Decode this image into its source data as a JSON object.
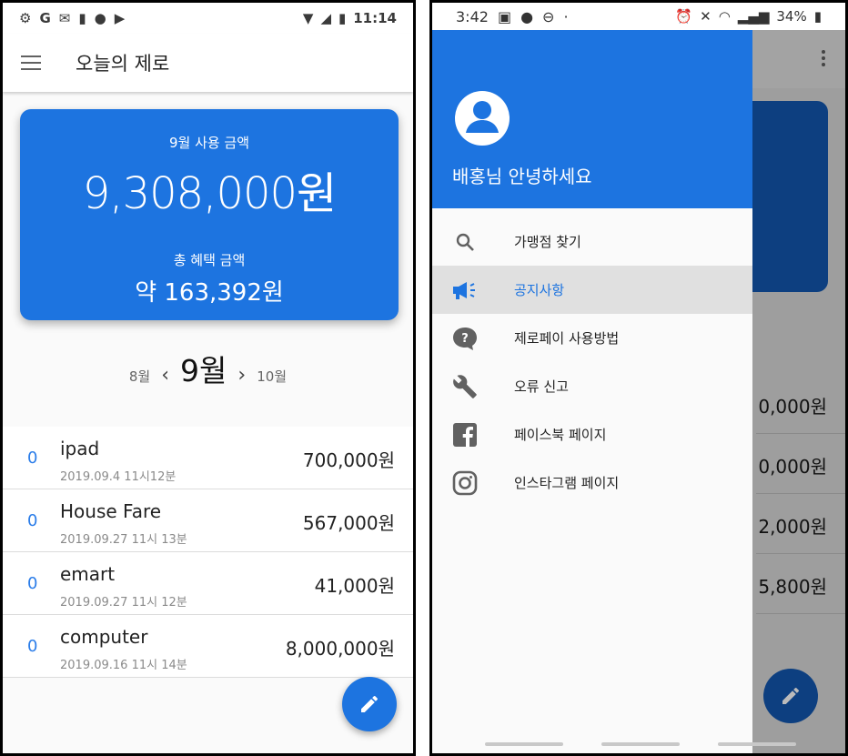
{
  "left_screen": {
    "status_bar": {
      "time": "11:14"
    },
    "appbar": {
      "title": "오늘의 제로"
    },
    "summary_card": {
      "month_label": "9월 사용 금액",
      "month_amount": "9,308,000원",
      "benefit_label": "총 혜택 금액",
      "benefit_amount": "약 163,392원"
    },
    "month_nav": {
      "prev": "8월",
      "current": "9월",
      "next": "10월"
    },
    "transactions": [
      {
        "badge": "0",
        "name": "ipad",
        "date": "2019.09.4 11시12분",
        "amount": "700,000원"
      },
      {
        "badge": "0",
        "name": "House Fare",
        "date": "2019.09.27 11시 13분",
        "amount": "567,000원"
      },
      {
        "badge": "0",
        "name": "emart",
        "date": "2019.09.27 11시 12분",
        "amount": "41,000원"
      },
      {
        "badge": "0",
        "name": "computer",
        "date": "2019.09.16 11시 14분",
        "amount": "8,000,000원"
      }
    ],
    "fab_icon": "pencil-icon",
    "accent_color": "#1d74e0"
  },
  "right_screen": {
    "status_bar": {
      "time": "3:42",
      "battery": "34%"
    },
    "drawer": {
      "greeting": "배홍님 안녕하세요",
      "items": [
        {
          "label": "가맹점 찾기",
          "icon": "search-icon"
        },
        {
          "label": "공지사항",
          "icon": "megaphone-icon",
          "active": true
        },
        {
          "label": "제로페이 사용방법",
          "icon": "help-bubble-icon"
        },
        {
          "label": "오류 신고",
          "icon": "wrench-icon"
        },
        {
          "label": "페이스북 페이지",
          "icon": "facebook-icon"
        },
        {
          "label": "인스타그램 페이지",
          "icon": "instagram-icon"
        }
      ]
    },
    "background_amounts": [
      "0,000원",
      "0,000원",
      "2,000원",
      "5,800원"
    ]
  }
}
